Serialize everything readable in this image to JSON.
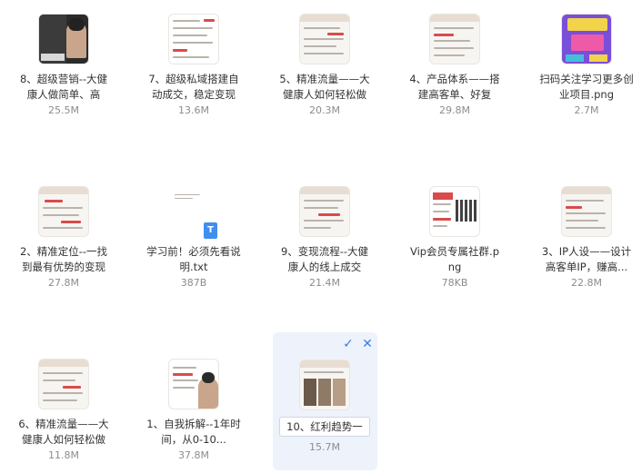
{
  "files": [
    {
      "name": "8、超级营销--大健康人做简单、高",
      "size": "25.5M",
      "thumb": "photo-dark"
    },
    {
      "name": "7、超级私域搭建自动成交，稳定变现",
      "size": "13.6M",
      "thumb": "doc"
    },
    {
      "name": "5、精准流量——大健康人如何轻松做",
      "size": "20.3M",
      "thumb": "doc"
    },
    {
      "name": "4、产品体系——搭建高客单、好复",
      "size": "29.8M",
      "thumb": "doc"
    },
    {
      "name": "扫码关注学习更多创业项目.png",
      "size": "2.7M",
      "thumb": "poster"
    },
    {
      "name": "2、精准定位--一找到最有优势的变现",
      "size": "27.8M",
      "thumb": "doc"
    },
    {
      "name": "学习前！必须先看说明.txt",
      "size": "387B",
      "thumb": "txt"
    },
    {
      "name": "9、变现流程--大健康人的线上成交",
      "size": "21.4M",
      "thumb": "doc"
    },
    {
      "name": "Vip会员专属社群.png",
      "size": "78KB",
      "thumb": "qr"
    },
    {
      "name": "3、IP人设——设计高客单IP，赚高...",
      "size": "22.8M",
      "thumb": "doc"
    },
    {
      "name": "6、精准流量——大健康人如何轻松做",
      "size": "11.8M",
      "thumb": "doc"
    },
    {
      "name": "1、自我拆解--1年时间，从0-10...",
      "size": "37.8M",
      "thumb": "doc-photo"
    }
  ],
  "renaming": {
    "value": "10、红利趋势一",
    "size": "15.7M",
    "confirm_icon": "check-icon",
    "cancel_icon": "close-icon"
  },
  "txt_badge": "T",
  "colors": {
    "accent": "#3a7bf2",
    "selected_bg": "#eef2fb"
  }
}
